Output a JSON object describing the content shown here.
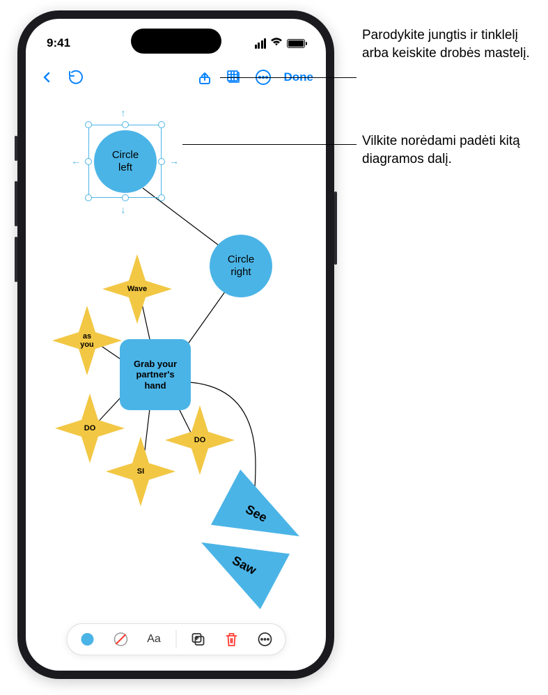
{
  "status": {
    "time": "9:41"
  },
  "toolbar": {
    "done": "Done"
  },
  "shapes": {
    "circle_left": "Circle\nleft",
    "circle_right": "Circle\nright",
    "grab": "Grab your\npartner's\nhand",
    "wave": "Wave",
    "as_you": "as\nyou",
    "do1": "DO",
    "do2": "DO",
    "si": "SI",
    "see": "See",
    "saw": "Saw"
  },
  "bottom_toolbar": {
    "text_tool": "Aa"
  },
  "callouts": {
    "grid": "Parodykite jungtis ir tinklelį arba keiskite drobės mastelį.",
    "drag": "Vilkite norėdami padėti kitą diagramos dalį."
  },
  "colors": {
    "blue": "#4bb4e6",
    "yellow": "#f2c744",
    "accent": "#0a84ff"
  }
}
